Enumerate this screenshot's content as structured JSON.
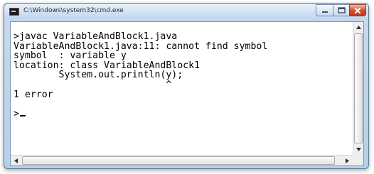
{
  "window": {
    "title": "C:\\Windows\\system32\\cmd.exe",
    "icons": {
      "app": "console-icon",
      "minimize": "minimize-icon",
      "maximize": "maximize-icon",
      "close": "close-icon"
    }
  },
  "console": {
    "lines": [
      ">javac VariableAndBlock1.java",
      "VariableAndBlock1.java:11: cannot find symbol",
      "symbol  : variable y",
      "location: class VariableAndBlock1",
      "        System.out.println(y);",
      "                           ^",
      "1 error",
      "",
      ">"
    ]
  },
  "colors": {
    "console_background": "#ffffff",
    "console_text": "#000000",
    "close_button": "#d34a2b",
    "frame": "#c4d9ef"
  }
}
